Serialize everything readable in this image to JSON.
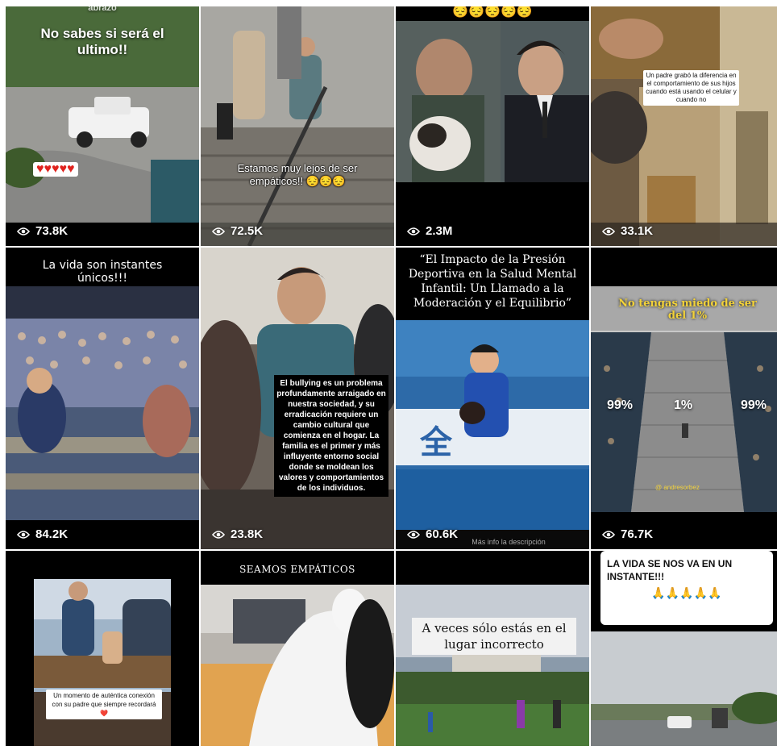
{
  "tiles": [
    {
      "caption": "No sabes si será el ultimo!!",
      "top_text": "abrazo",
      "hearts": "♥♥♥♥♥",
      "views": "73.8K"
    },
    {
      "caption": "Estamos muy lejos de ser empáticos!!",
      "emoji": "😔😔😔",
      "views": "72.5K"
    },
    {
      "top_emoji": "😔😔😔😔😔",
      "views": "2.3M"
    },
    {
      "caption": "Un padre grabó la diferencia en el comportamiento de sus hijos cuando está usando el celular y cuando no",
      "views": "33.1K"
    },
    {
      "caption": "La vida son instantes únicos!!!",
      "views": "84.2K"
    },
    {
      "caption": "El bullying es un problema profundamente arraigado en nuestra sociedad, y su erradicación requiere un cambio cultural que comienza en el hogar. La familia es el primer y más influyente entorno social donde se moldean los valores y comportamientos de los individuos.",
      "views": "23.8K"
    },
    {
      "caption": "“El Impacto de la Presión Deportiva en la Salud Mental Infantil: Un Llamado a la Moderación y el Equilibrio”",
      "footer": "Más info la descripción",
      "views": "60.6K"
    },
    {
      "caption": "No tengas miedo de ser del 1%",
      "left_pct": "99%",
      "mid_pct": "1%",
      "right_pct": "99%",
      "handle": "@ andresorbez",
      "views": "76.7K"
    },
    {
      "caption": "Un momento de auténtica conexión con su padre que siempre recordará",
      "emoji": "❤️"
    },
    {
      "caption": "SEAMOS EMPÁTICOS"
    },
    {
      "caption": "A veces sólo estás en el lugar incorrecto"
    },
    {
      "caption": "LA VIDA SE NOS VA EN UN INSTANTE!!!",
      "emoji": "🙏🙏🙏🙏🙏"
    }
  ]
}
